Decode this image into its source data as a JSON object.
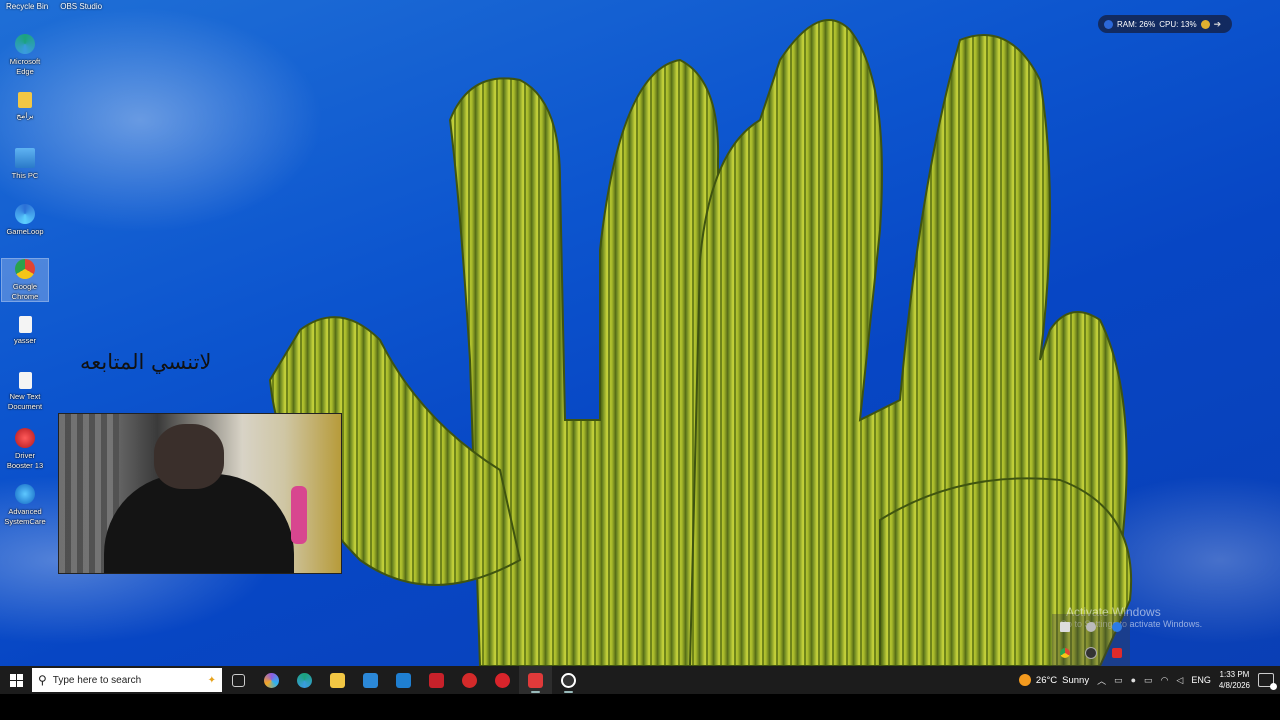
{
  "desktop": {
    "top_labels": [
      "Recycle Bin",
      "OBS Studio"
    ],
    "icons": [
      {
        "label": "Microsoft Edge",
        "icon": "edge-icon",
        "color": "#1ba37c"
      },
      {
        "label": "برامج",
        "icon": "folder-icon",
        "color": "#f2c744"
      },
      {
        "label": "This PC",
        "icon": "monitor-icon",
        "color": "#3a9be0"
      },
      {
        "label": "GameLoop",
        "icon": "gameloop-icon",
        "color": "#2b6fd6"
      },
      {
        "label": "Google Chrome",
        "icon": "chrome-icon",
        "color": "#e04433"
      },
      {
        "label": "yasser",
        "icon": "file-icon",
        "color": "#f4f4f4"
      },
      {
        "label": "New Text Document",
        "icon": "text-file-icon",
        "color": "#f4f4f4"
      },
      {
        "label": "Driver Booster 13",
        "icon": "driver-booster-icon",
        "color": "#d9242b"
      },
      {
        "label": "Advanced SystemCare",
        "icon": "advanced-systemcare-icon",
        "color": "#1f7fd1"
      }
    ],
    "arabic_note": "لاتنسي المتابعه",
    "system_monitor": {
      "ram": "RAM: 26%",
      "cpu": "CPU: 13%"
    },
    "watermark": {
      "title": "Activate Windows",
      "subtitle": "Go to Settings to activate Windows."
    }
  },
  "taskbar": {
    "search_placeholder": "Type here to search",
    "apps": [
      {
        "name": "task-view",
        "color": "#cccccc"
      },
      {
        "name": "copilot",
        "color": "#8f5ce0"
      },
      {
        "name": "edge",
        "color": "#1ba37c"
      },
      {
        "name": "file-explorer",
        "color": "#f2c744"
      },
      {
        "name": "microsoft-store",
        "color": "#2b88d8"
      },
      {
        "name": "outlook",
        "color": "#1f7fd1"
      },
      {
        "name": "red-app",
        "color": "#c8212a"
      },
      {
        "name": "red-app-2",
        "color": "#d42a2a"
      },
      {
        "name": "driver-booster",
        "color": "#d9242b"
      },
      {
        "name": "obs-red",
        "color": "#e03a3a"
      },
      {
        "name": "obs-studio",
        "color": "#ffffff"
      }
    ],
    "weather": {
      "temp": "26°C",
      "condition": "Sunny"
    },
    "language": "ENG",
    "time": "1:33 PM",
    "date": "4/8/2026"
  }
}
